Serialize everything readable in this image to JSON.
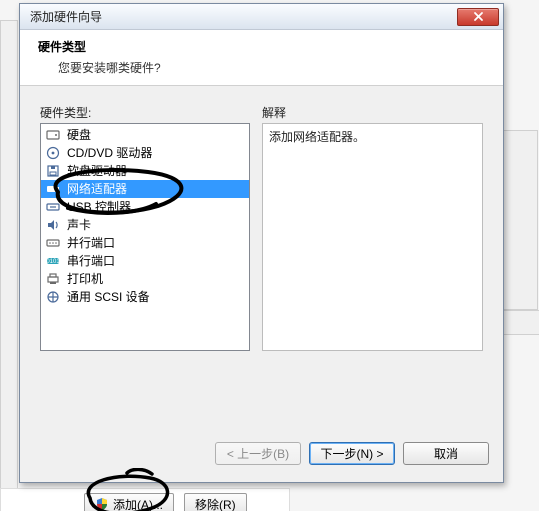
{
  "dialog": {
    "title": "添加硬件向导",
    "heading": "硬件类型",
    "subheading": "您要安装哪类硬件?",
    "list_label": "硬件类型:",
    "explain_label": "解释",
    "explain_text": "添加网络适配器。",
    "back_btn": "< 上一步(B)",
    "next_btn": "下一步(N) >",
    "cancel_btn": "取消"
  },
  "items": [
    {
      "icon": "hdd-icon",
      "label": "硬盘"
    },
    {
      "icon": "disc-icon",
      "label": "CD/DVD 驱动器"
    },
    {
      "icon": "floppy-icon",
      "label": "软盘驱动器"
    },
    {
      "icon": "nic-icon",
      "label": "网络适配器",
      "selected": true
    },
    {
      "icon": "usb-icon",
      "label": "USB 控制器"
    },
    {
      "icon": "sound-icon",
      "label": "声卡"
    },
    {
      "icon": "parallel-icon",
      "label": "并行端口"
    },
    {
      "icon": "serial-icon",
      "label": "串行端口"
    },
    {
      "icon": "printer-icon",
      "label": "打印机"
    },
    {
      "icon": "scsi-icon",
      "label": "通用 SCSI 设备"
    }
  ],
  "parent": {
    "add_btn": "添加(A)...",
    "remove_btn": "移除(R)"
  },
  "colors": {
    "selection": "#3399ff",
    "close_bg": "#c8392c",
    "default_border": "#2f6fb3"
  }
}
